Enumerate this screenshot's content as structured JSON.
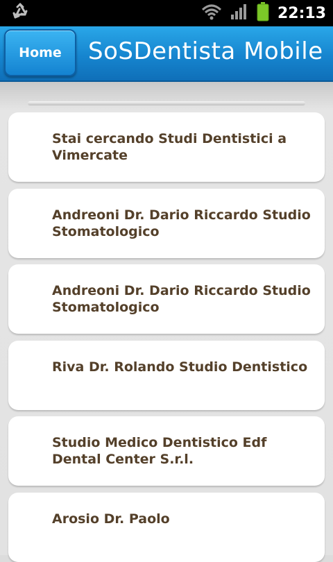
{
  "status_bar": {
    "time": "22:13",
    "icons": [
      "recycle-icon",
      "wifi-icon",
      "signal-icon",
      "battery-icon"
    ]
  },
  "header": {
    "home_label": "Home",
    "title": "SoSDentista Mobile"
  },
  "list": {
    "items": [
      {
        "label": "Stai cercando Studi Dentistici a Vimercate"
      },
      {
        "label": "Andreoni Dr. Dario Riccardo Studio Stomatologico"
      },
      {
        "label": "Andreoni Dr. Dario Riccardo Studio Stomatologico"
      },
      {
        "label": "Riva Dr. Rolando Studio Dentistico"
      },
      {
        "label": "Studio Medico Dentistico Edf Dental Center S.r.l."
      },
      {
        "label": "Arosio Dr. Paolo"
      }
    ]
  },
  "colors": {
    "header_blue": "#1685cf",
    "item_text": "#54402a",
    "battery_green": "#7cc828"
  }
}
